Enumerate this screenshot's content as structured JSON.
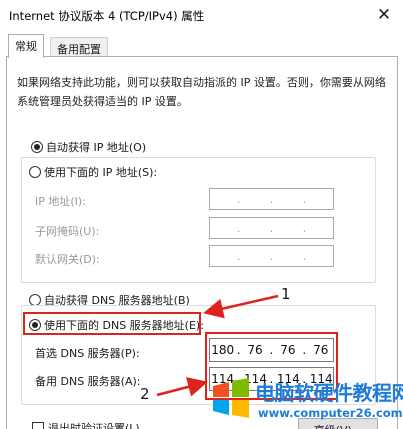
{
  "window": {
    "title": "Internet 协议版本 4 (TCP/IPv4) 属性",
    "close_glyph": "✕"
  },
  "tabs": [
    {
      "label": "常规",
      "active": true
    },
    {
      "label": "备用配置",
      "active": false
    }
  ],
  "description": "如果网络支持此功能，则可以获取自动指派的 IP 设置。否则，你需要从网络系统管理员处获得适当的 IP 设置。",
  "ip_section": {
    "auto_label": "自动获得 IP 地址(O)",
    "auto_checked": true,
    "manual_label": "使用下面的 IP 地址(S):",
    "manual_checked": false,
    "fields": [
      {
        "label": "IP 地址(I):",
        "octets": [
          "",
          "",
          "",
          ""
        ]
      },
      {
        "label": "子网掩码(U):",
        "octets": [
          "",
          "",
          "",
          ""
        ]
      },
      {
        "label": "默认网关(D):",
        "octets": [
          "",
          "",
          "",
          ""
        ]
      }
    ]
  },
  "dns_section": {
    "auto_label": "自动获得 DNS 服务器地址(B)",
    "auto_checked": false,
    "manual_label": "使用下面的 DNS 服务器地址(E):",
    "manual_checked": true,
    "preferred": {
      "label": "首选 DNS 服务器(P):",
      "octets": [
        "180",
        "76",
        "76",
        "76"
      ]
    },
    "alternate": {
      "label": "备用 DNS 服务器(A):",
      "octets": [
        "114",
        "114",
        "114",
        "114"
      ]
    }
  },
  "footer": {
    "validate_label": "退出时验证设置(L)",
    "advanced_label": "高级(V)..."
  },
  "annotations": {
    "callout_1": "1",
    "callout_2": "2",
    "highlight_color": "#e0221c"
  },
  "watermark": {
    "text_cn": "电脑软硬件教程网",
    "url": "www.computer26.com",
    "color": "#1e7bd8"
  },
  "icons": {
    "close": "close-icon",
    "logo": "windows-logo-icon"
  }
}
